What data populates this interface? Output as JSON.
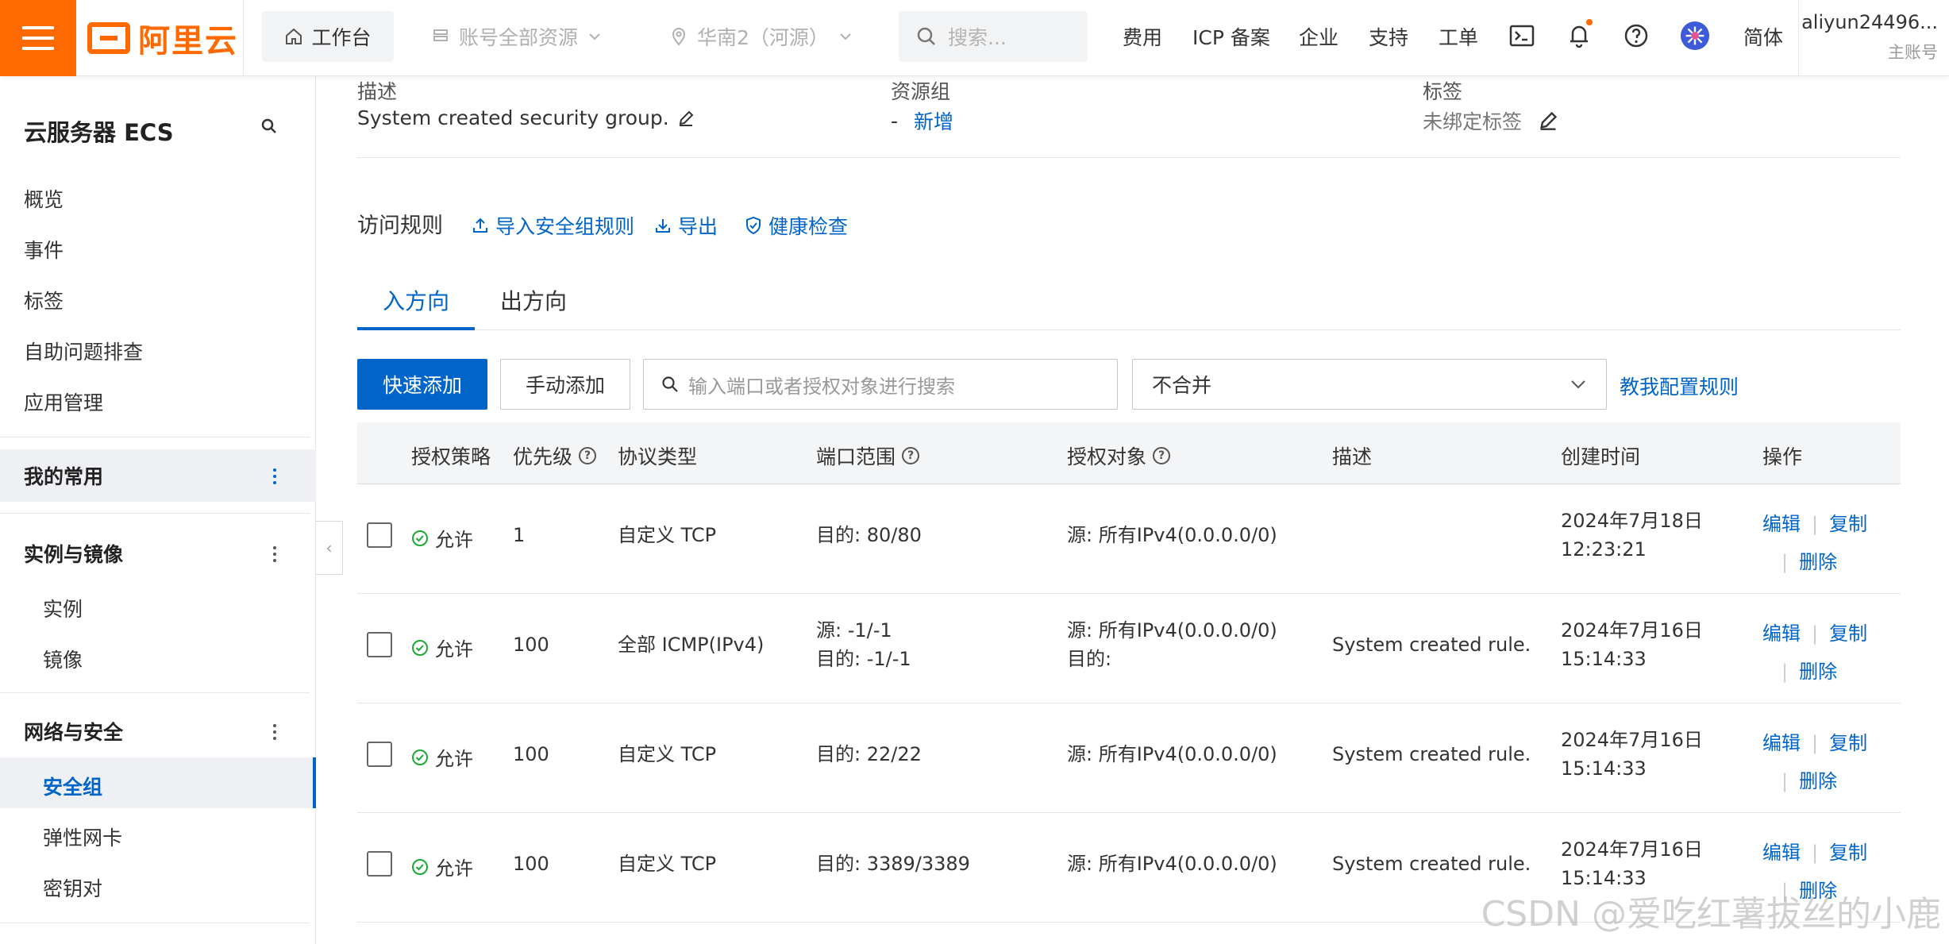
{
  "topbar": {
    "logo_text": "阿里云",
    "workbench": "工作台",
    "account_resources": "账号全部资源",
    "region": "华南2（河源）",
    "search_placeholder": "搜索...",
    "links": [
      "费用",
      "ICP 备案",
      "企业",
      "支持",
      "工单"
    ],
    "lang": "简体",
    "account_name": "aliyun24496...",
    "account_role": "主账号",
    "accent_color": "#ff6a00"
  },
  "sidebar": {
    "title": "云服务器 ECS",
    "items": [
      "概览",
      "事件",
      "标签",
      "自助问题排查",
      "应用管理"
    ],
    "common_group": "我的常用",
    "instance_group": "实例与镜像",
    "instance_items": [
      "实例",
      "镜像"
    ],
    "network_group": "网络与安全",
    "network_items": [
      "安全组",
      "弹性网卡",
      "密钥对"
    ],
    "active_item": "安全组"
  },
  "info": {
    "desc_label": "描述",
    "desc_value": "System created security group.",
    "rg_label": "资源组",
    "rg_dash": "-",
    "rg_add": "新增",
    "tag_label": "标签",
    "tag_value": "未绑定标签"
  },
  "rules": {
    "title": "访问规则",
    "import": "导入安全组规则",
    "export": "导出",
    "health": "健康检查",
    "tabs": [
      "入方向",
      "出方向"
    ],
    "quick_add": "快速添加",
    "manual_add": "手动添加",
    "search_placeholder": "输入端口或者授权对象进行搜索",
    "merge_select": "不合并",
    "help_link": "教我配置规则"
  },
  "table": {
    "headers": [
      "授权策略",
      "优先级",
      "协议类型",
      "端口范围",
      "授权对象",
      "描述",
      "创建时间",
      "操作"
    ],
    "rows": [
      {
        "policy": "允许",
        "priority": "1",
        "protocol": "自定义 TCP",
        "port1": "目的: 80/80",
        "port2": "",
        "target1": "源: 所有IPv4(0.0.0.0/0)",
        "target2": "",
        "desc": "",
        "date": "2024年7月18日",
        "time": "12:23:21"
      },
      {
        "policy": "允许",
        "priority": "100",
        "protocol": "全部 ICMP(IPv4)",
        "port1": "源: -1/-1",
        "port2": "目的: -1/-1",
        "target1": "源: 所有IPv4(0.0.0.0/0)",
        "target2": "目的:",
        "desc": "System created rule.",
        "date": "2024年7月16日",
        "time": "15:14:33"
      },
      {
        "policy": "允许",
        "priority": "100",
        "protocol": "自定义 TCP",
        "port1": "目的: 22/22",
        "port2": "",
        "target1": "源: 所有IPv4(0.0.0.0/0)",
        "target2": "",
        "desc": "System created rule.",
        "date": "2024年7月16日",
        "time": "15:14:33"
      },
      {
        "policy": "允许",
        "priority": "100",
        "protocol": "自定义 TCP",
        "port1": "目的: 3389/3389",
        "port2": "",
        "target1": "源: 所有IPv4(0.0.0.0/0)",
        "target2": "",
        "desc": "System created rule.",
        "date": "2024年7月16日",
        "time": "15:14:33"
      }
    ],
    "op_edit": "编辑",
    "op_copy": "复制",
    "op_delete": "删除"
  },
  "watermark": "CSDN @爱吃红薯拔丝的小鹿"
}
